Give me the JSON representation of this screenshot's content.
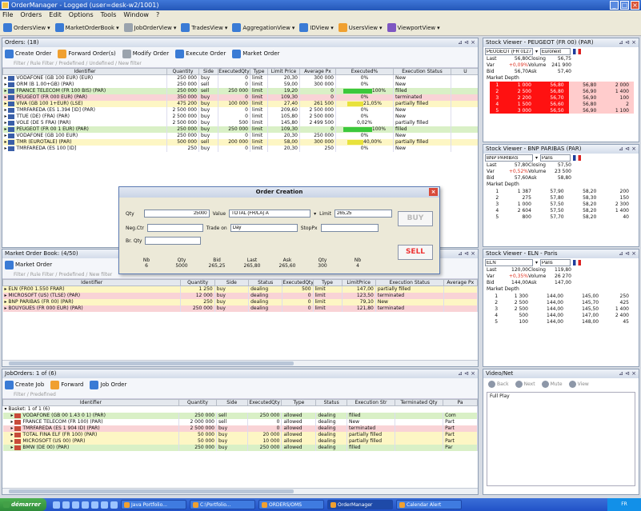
{
  "app": {
    "title": "OrderManager - Logged (user=desk-w2/1001)"
  },
  "menu": [
    "File",
    "Orders",
    "Edit",
    "Options",
    "Tools",
    "Window",
    "?"
  ],
  "toolbar": [
    {
      "label": "OrdersView",
      "icon": "orders-view-icon",
      "color": "blue"
    },
    {
      "label": "MarketOrderBook",
      "icon": "order-book-icon",
      "color": "blue"
    },
    {
      "label": "JobOrderView",
      "icon": "job-orders-icon",
      "color": "gray"
    },
    {
      "label": "TradesView",
      "icon": "trades-icon",
      "color": "blue"
    },
    {
      "label": "AggregationView",
      "icon": "aggregation-icon",
      "color": "blue"
    },
    {
      "label": "IDView",
      "icon": "id-icon",
      "color": "blue"
    },
    {
      "label": "UsersView",
      "icon": "users-icon",
      "color": "orange"
    },
    {
      "label": "ViewportView",
      "icon": "viewport-icon",
      "color": "purple"
    }
  ],
  "orders": {
    "title": "Orders: (18)",
    "actions": [
      "Create Order",
      "Forward Order(s)",
      "Modify Order",
      "Execute Order",
      "Market Order"
    ],
    "filter": "Filter / Rule Filter / Predefined / Undefined / New filter",
    "columns": [
      "Identifier",
      "Quantity",
      "Side",
      "ExecutedQty",
      "Type",
      "Limit Price",
      "Average Px",
      "Executed%",
      "Execution Status",
      "U"
    ],
    "rows": [
      {
        "c": "r-white",
        "id": "VODAFONE (GB 100 EUR) (EUR)",
        "q": "250 000",
        "s": "buy",
        "e": "0",
        "t": "limit",
        "l": "20,30",
        "a": "300 000",
        "pct": "0%",
        "st": "New",
        "bar": ""
      },
      {
        "c": "r-white",
        "id": "ORM (B 1.00+GB) (PAR)",
        "q": "250 000",
        "s": "sell",
        "e": "0",
        "t": "limit",
        "l": "59,00",
        "a": "300 000",
        "pct": "0%",
        "st": "New",
        "bar": ""
      },
      {
        "c": "r-green",
        "id": "FRANCE TELECOM (FR 100 BIS) (PAR)",
        "q": "250 000",
        "s": "sell",
        "e": "250 000",
        "t": "limit",
        "l": "19,20",
        "a": "0",
        "pct": "100%",
        "st": "filled",
        "bar": "green"
      },
      {
        "c": "r-pink",
        "id": "PEUGEOT (FR 000 EUR) (PAR)",
        "q": "350 000",
        "s": "buy",
        "e": "0",
        "t": "limit",
        "l": "109,30",
        "a": "0",
        "pct": "0%",
        "st": "terminated",
        "bar": ""
      },
      {
        "c": "r-yellow",
        "id": "VIVA (GB 100 1+EUR) (LSE)",
        "q": "475 200",
        "s": "buy",
        "e": "100 000",
        "t": "limit",
        "l": "27,40",
        "a": "261 500",
        "pct": "21,05%",
        "st": "partially filled",
        "bar": "yellow"
      },
      {
        "c": "r-white",
        "id": "TMRFAREDA (ES 1.394 [ID] (PAR)",
        "q": "2 500 000",
        "s": "buy",
        "e": "0",
        "t": "limit",
        "l": "209,60",
        "a": "2 500 000",
        "pct": "0%",
        "st": "New",
        "bar": ""
      },
      {
        "c": "r-white",
        "id": "TTUE (DE) (FRA) (PAR)",
        "q": "2 500 000",
        "s": "buy",
        "e": "0",
        "t": "limit",
        "l": "105,80",
        "a": "2 500 000",
        "pct": "0%",
        "st": "New",
        "bar": ""
      },
      {
        "c": "r-white",
        "id": "VOLE (DE 5 FRA) (PAR)",
        "q": "2 500 000",
        "s": "buy",
        "e": "500",
        "t": "limit",
        "l": "145,80",
        "a": "2 499 500",
        "pct": "0,02%",
        "st": "partially filled",
        "bar": ""
      },
      {
        "c": "r-green",
        "id": "PEUGEOT (FR 00 1 EUR) (PAR)",
        "q": "250 000",
        "s": "buy",
        "e": "250 000",
        "t": "limit",
        "l": "109,30",
        "a": "0",
        "pct": "100%",
        "st": "filled",
        "bar": "green"
      },
      {
        "c": "r-white",
        "id": "VODAFONE (GB 100 EUR)",
        "q": "250 000",
        "s": "buy",
        "e": "0",
        "t": "limit",
        "l": "20,30",
        "a": "250 000",
        "pct": "0%",
        "st": "New",
        "bar": ""
      },
      {
        "c": "r-yellow",
        "id": "TMR (EUROTALE) (PAR)",
        "q": "500 000",
        "s": "sell",
        "e": "200 000",
        "t": "limit",
        "l": "58,00",
        "a": "300 000",
        "pct": "40,00%",
        "st": "partially filled",
        "bar": "yellow"
      },
      {
        "c": "r-white",
        "id": "TMRFAREDA (ES 100 [ID]",
        "q": "250",
        "s": "buy",
        "e": "0",
        "t": "limit",
        "l": "20,30",
        "a": "250",
        "pct": "0%",
        "st": "New",
        "bar": ""
      }
    ]
  },
  "dialog": {
    "title": "Order Creation",
    "qty_label": "Qty",
    "qty_value": "25000",
    "value_label": "Value",
    "value_value": "TOTAL (FR/LA) A",
    "limit_label": "Limit",
    "limit_value": "265,25",
    "nego_label": "Neg.Ctr",
    "tradeon_label": "Trade on",
    "tradeon_value": "Day",
    "stoppx_label": "StopPx",
    "broker_label": "Br. Qty",
    "buy_label": "BUY",
    "sell_label": "SELL",
    "stats_headers": [
      "Nb",
      "Qty",
      "Bid",
      "Last",
      "Ask",
      "Qty",
      "Nb"
    ],
    "stats_values": [
      "6",
      "5000",
      "265,25",
      "265,80",
      "265,60",
      "300",
      "4"
    ]
  },
  "book": {
    "title": "Market Order Book: (4/50)",
    "actions": [
      "Market Order"
    ],
    "filter": "Filter / Rule Filter / Predefined / New filter",
    "columns": [
      "Identifier",
      "Quantity",
      "Side",
      "Status",
      "ExecutedQty",
      "Type",
      "LimitPrice",
      "Execution Status",
      "Average Px"
    ],
    "rows": [
      {
        "c": "r-yellow",
        "id": "ELN (FR00 1.550 FRAR)",
        "q": "1 250",
        "s": "buy",
        "st": "dealing",
        "e": "500",
        "t": "limit",
        "l": "147,00",
        "x": "partially filled"
      },
      {
        "c": "r-pink",
        "id": "MICROSOFT (US) (TLSE) (PAR)",
        "q": "12 000",
        "s": "buy",
        "st": "dealing",
        "e": "0",
        "t": "limit",
        "l": "123,50",
        "x": "terminated"
      },
      {
        "c": "r-yellow",
        "id": "BNP PARIBAS (FR 00) (PAR)",
        "q": "250",
        "s": "buy",
        "st": "dealing",
        "e": "0",
        "t": "limit",
        "l": "79,10",
        "x": "New"
      },
      {
        "c": "r-pink",
        "id": "BOUYGUES (FR 000 EUR) (PAR)",
        "q": "250 000",
        "s": "buy",
        "st": "dealing",
        "e": "0",
        "t": "limit",
        "l": "121,80",
        "x": "terminated"
      }
    ]
  },
  "joborders": {
    "title": "JobOrders: 1 of (6)",
    "actions": [
      "Create Job",
      "Forward",
      "Job Order"
    ],
    "filter": "Filter / Predefined",
    "columns": [
      "Identifier",
      "Quantity",
      "Side",
      "ExecutedQty",
      "Type",
      "Status",
      "Execution Str",
      "Terminated Qty",
      "Pa"
    ],
    "group": "Basket: 1 of 1 (6)",
    "rows": [
      {
        "c": "r-green",
        "id": "VODAFONE (GB 00 1.43 0 1) (PAR)",
        "q": "250 000",
        "s": "sell",
        "e": "250 000",
        "t": "allowed",
        "st": "dealing",
        "x": "filled",
        "p": "Com"
      },
      {
        "c": "r-white",
        "id": "FRANCE TELECOM (FR 100) (PAR)",
        "q": "2 000 000",
        "s": "sell",
        "e": "0",
        "t": "allowed",
        "st": "dealing",
        "x": "New",
        "p": "Part"
      },
      {
        "c": "r-pink",
        "id": "TMRFAREDA (ES 1 904 ID) (PAR)",
        "q": "2 500 000",
        "s": "buy",
        "e": "0",
        "t": "allowed",
        "st": "dealing",
        "x": "terminated",
        "p": "Part"
      },
      {
        "c": "r-yellow",
        "id": "TOTAL FINA ELF (FR 100) (PAR)",
        "q": "50 000",
        "s": "buy",
        "e": "20 000",
        "t": "allowed",
        "st": "dealing",
        "x": "partially filled",
        "p": "Part"
      },
      {
        "c": "r-yellow",
        "id": "MICROSOFT (US 00) (PAR)",
        "q": "50 000",
        "s": "buy",
        "e": "10 000",
        "t": "allowed",
        "st": "dealing",
        "x": "partially filled",
        "p": "Part"
      },
      {
        "c": "r-green",
        "id": "BMW (DE 00) (PAR)",
        "q": "250 000",
        "s": "buy",
        "e": "250 000",
        "t": "allowed",
        "st": "dealing",
        "x": "filled",
        "p": "Par"
      }
    ]
  },
  "quotes": [
    {
      "title": "Stock Viewer - PEUGEOT (FR 00) (PAR)",
      "symbol": "PEUGEOT (FR 0127)",
      "market": "Euronext",
      "kv": [
        [
          "Last",
          "56,80",
          "Closing",
          "56,75"
        ],
        [
          "Var",
          "+0,09%",
          "Volume",
          "241 900"
        ],
        [
          "Bid",
          "56,70",
          "Ask",
          "57,40"
        ]
      ],
      "depth_title": "Market Depth",
      "depth": [
        {
          "hl": true,
          "a": "1",
          "b": "1 000",
          "c": "56,80",
          "d": "56,80",
          "e": "2 000"
        },
        {
          "hl": true,
          "a": "2",
          "b": "2 500",
          "c": "56,80",
          "d": "56,90",
          "e": "1 400"
        },
        {
          "hl": true,
          "a": "3",
          "b": "2 200",
          "c": "56,70",
          "d": "56,90",
          "e": "100"
        },
        {
          "hl": true,
          "a": "4",
          "b": "1 500",
          "c": "56,60",
          "d": "56,80",
          "e": "2"
        },
        {
          "hl": true,
          "a": "5",
          "b": "3 000",
          "c": "56,50",
          "d": "56,90",
          "e": "1 100"
        }
      ]
    },
    {
      "title": "Stock Viewer - BNP PARIBAS (PAR)",
      "symbol": "BNP PARIBAS",
      "market": "Paris",
      "kv": [
        [
          "Last",
          "57,80",
          "Closing",
          "57,50"
        ],
        [
          "Var",
          "+0,52%",
          "Volume",
          "23 500"
        ],
        [
          "Bid",
          "57,60",
          "Ask",
          "58,80"
        ]
      ],
      "depth_title": "Market Depth",
      "depth": [
        {
          "hl": false,
          "a": "1",
          "b": "1 387",
          "c": "57,90",
          "d": "58,20",
          "e": "200"
        },
        {
          "hl": false,
          "a": "2",
          "b": "275",
          "c": "57,80",
          "d": "58,30",
          "e": "150"
        },
        {
          "hl": false,
          "a": "3",
          "b": "1 000",
          "c": "57,50",
          "d": "58,20",
          "e": "2 300"
        },
        {
          "hl": false,
          "a": "4",
          "b": "2 604",
          "c": "57,50",
          "d": "58,20",
          "e": "1 400"
        },
        {
          "hl": false,
          "a": "5",
          "b": "800",
          "c": "57,70",
          "d": "58,20",
          "e": "40"
        }
      ]
    },
    {
      "title": "Stock Viewer - ELN - Paris",
      "symbol": "ELN",
      "market": "Paris",
      "kv": [
        [
          "Last",
          "120,00",
          "Closing",
          "119,80"
        ],
        [
          "Var",
          "+0,35%",
          "Volume",
          "26 270"
        ],
        [
          "Bid",
          "144,00",
          "Ask",
          "147,00"
        ]
      ],
      "depth_title": "Market Depth",
      "depth": [
        {
          "hl": false,
          "a": "1",
          "b": "1 300",
          "c": "144,00",
          "d": "145,00",
          "e": "250"
        },
        {
          "hl": false,
          "a": "2",
          "b": "2 500",
          "c": "144,00",
          "d": "145,70",
          "e": "425"
        },
        {
          "hl": false,
          "a": "3",
          "b": "2 500",
          "c": "144,00",
          "d": "145,50",
          "e": "1 400"
        },
        {
          "hl": false,
          "a": "4",
          "b": "500",
          "c": "144,00",
          "d": "147,00",
          "e": "2 400"
        },
        {
          "hl": false,
          "a": "5",
          "b": "100",
          "c": "144,00",
          "d": "148,00",
          "e": "45"
        }
      ]
    }
  ],
  "media": {
    "title": "Video/Net",
    "items": [
      "Back",
      "Next",
      "Mute",
      "View"
    ],
    "list": "Full Play"
  },
  "taskbar": {
    "start": "démarrer",
    "tasks": [
      "Java Portfolio...",
      "C:\\Portfolio...",
      "ORDERS/OMS",
      "OrderManager",
      "Calendar Alert"
    ],
    "clock": "FR"
  }
}
